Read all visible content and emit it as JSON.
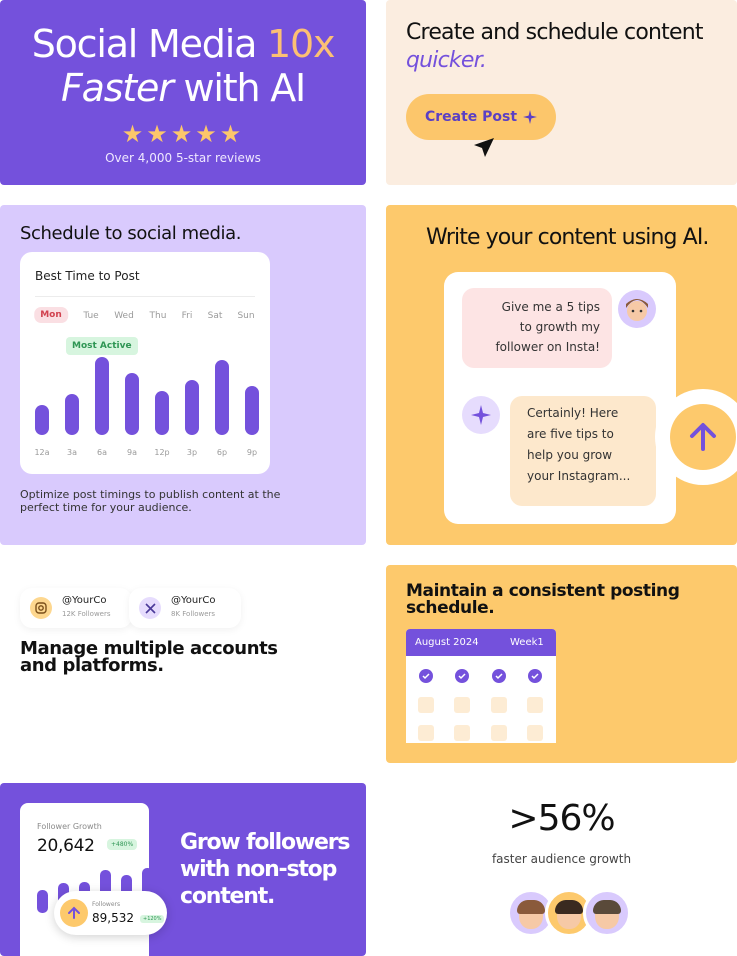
{
  "hero": {
    "title_part1": "Social Media ",
    "title_accent": "10x",
    "title_italic": "Faster",
    "title_part2": " with AI",
    "stars": "★★★★★",
    "reviews": "Over 4,000 5-star reviews"
  },
  "create": {
    "title": "Create and schedule content",
    "title_italic": "quicker.",
    "button_label": "Create Post"
  },
  "schedule": {
    "title": "Schedule to social media.",
    "panel_title": "Best Time to Post",
    "days": [
      "Mon",
      "Tue",
      "Wed",
      "Thu",
      "Fri",
      "Sat",
      "Sun"
    ],
    "selected_day": "Mon",
    "badge": "Most Active",
    "hours": [
      "12a",
      "3a",
      "6a",
      "9a",
      "12p",
      "3p",
      "6p",
      "9p"
    ],
    "activity": [
      0.38,
      0.52,
      1.0,
      0.8,
      0.56,
      0.7,
      0.96,
      0.63
    ],
    "description": "Optimize post timings to publish content at the perfect time for your audience."
  },
  "write": {
    "title": "Write your content using AI.",
    "prompt_lines": [
      "Give me a 5 tips",
      "to growth my",
      "follower on Insta!"
    ],
    "reply_lines": [
      "Certainly! Here",
      "are five tips to",
      "help you grow",
      "your Instagram..."
    ]
  },
  "accounts": {
    "items": [
      {
        "handle": "@YourCo",
        "followers": "12K Followers",
        "icon": "instagram-icon"
      },
      {
        "handle": "@YourCo",
        "followers": "8K Followers",
        "icon": "x-icon"
      }
    ],
    "title": "Manage multiple accounts and platforms."
  },
  "consistent": {
    "title": "Maintain a consistent posting schedule.",
    "month": "August 2024",
    "week": "Week1"
  },
  "grow": {
    "label": "Follower Growth",
    "count": "20,642",
    "change": "+480%",
    "bars": [
      0.45,
      0.6,
      0.62,
      0.85,
      0.75,
      0.9
    ],
    "popup_label": "Followers",
    "popup_count": "89,532",
    "popup_change": "+120%",
    "title": "Grow followers with non-stop content."
  },
  "stat": {
    "value": ">56%",
    "caption": "faster audience growth"
  },
  "colors": {
    "purple": "#7451dc",
    "yellow": "#fdc96c",
    "lavender": "#d9cafd",
    "cream": "#fbede0"
  }
}
